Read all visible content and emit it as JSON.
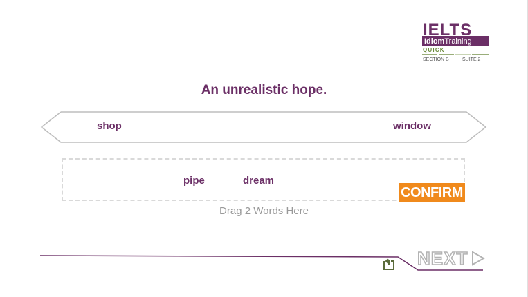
{
  "logo": {
    "brand": "IELTS",
    "subtitle_bold": "Idiom",
    "subtitle_rest": "Training",
    "tier": "QUICK",
    "section": "SECTION B",
    "suite": "SUITE 2"
  },
  "prompt": "An unrealistic hope.",
  "word_bank": {
    "words": [
      "shop",
      "window"
    ]
  },
  "drop_zone": {
    "placed_words": [
      "pipe",
      "dream"
    ],
    "hint": "Drag 2 Words Here"
  },
  "confirm_label": "CONFIRM",
  "next_label": "NEXT",
  "colors": {
    "accent_purple": "#6b2f66",
    "confirm_orange": "#f08a1c",
    "logo_green": "#9aae7a"
  }
}
